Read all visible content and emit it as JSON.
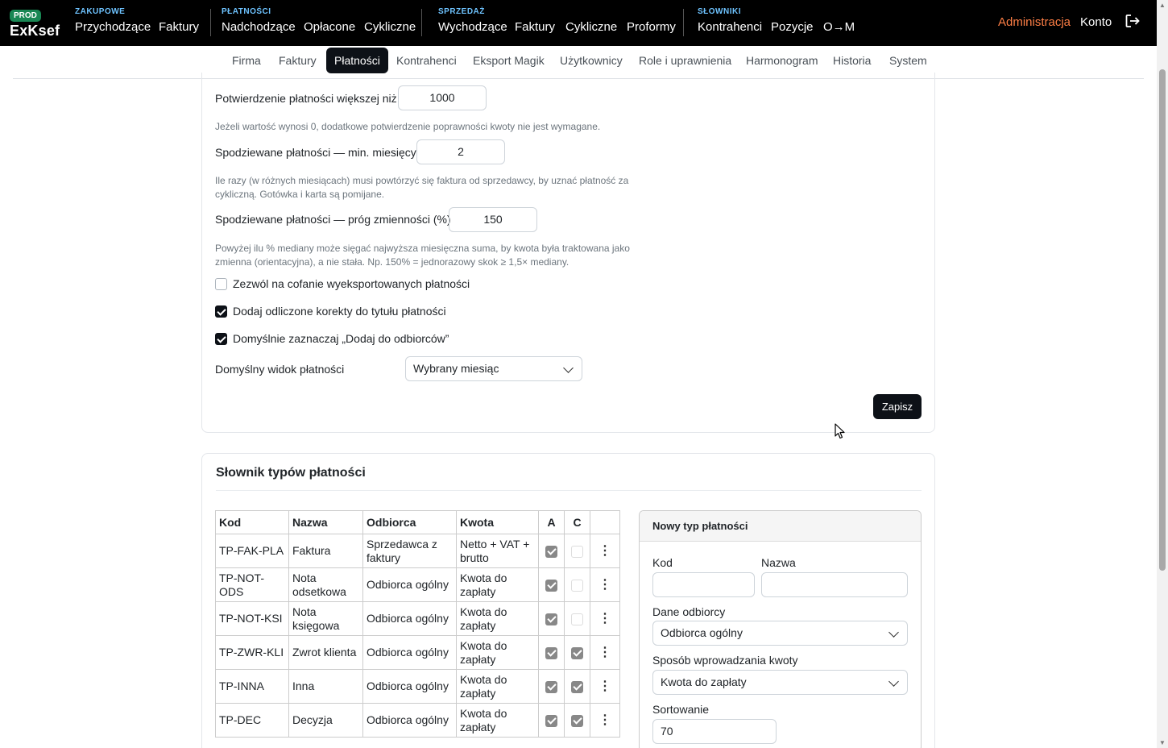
{
  "brand": {
    "badge": "PROD",
    "name": "ExKsef"
  },
  "nav": {
    "groups": [
      {
        "label": "ZAKUPOWE",
        "items": [
          "Przychodzące",
          "Faktury"
        ]
      },
      {
        "label": "PŁATNOŚCI",
        "items": [
          "Nadchodzące",
          "Opłacone",
          "Cykliczne"
        ]
      },
      {
        "label": "SPRZEDAŻ",
        "items": [
          "Wychodzące",
          "Faktury",
          "Cykliczne",
          "Proformy"
        ]
      },
      {
        "label": "SŁOWNIKI",
        "items": [
          "Kontrahenci",
          "Pozycje",
          "O→M"
        ]
      }
    ],
    "admin": "Administracja",
    "account": "Konto",
    "logout_icon": "logout-icon"
  },
  "tabs": [
    "Firma",
    "Faktury",
    "Płatności",
    "Kontrahenci",
    "Eksport Magik",
    "Użytkownicy",
    "Role i uprawnienia",
    "Harmonogram",
    "Historia",
    "System"
  ],
  "active_tab": "Płatności",
  "settings": {
    "confirm_label": "Potwierdzenie płatności większej niż",
    "confirm_value": "1000",
    "confirm_help": "Jeżeli wartość wynosi 0, dodatkowe potwierdzenie poprawności kwoty nie jest wymagane.",
    "min_months_label": "Spodziewane płatności — min. miesięcy",
    "min_months_value": "2",
    "min_months_help": "Ile razy (w różnych miesiącach) musi powtórzyć się faktura od sprzedawcy, by uznać płatność za cykliczną. Gotówka i karta są pomijane.",
    "variance_label": "Spodziewane płatności — próg zmienności (%)",
    "variance_value": "150",
    "variance_help": "Powyżej ilu % mediany może sięgać najwyższa miesięczna suma, by kwota była traktowana jako zmienna (orientacyjna), a nie stała. Np. 150% = jednorazowy skok ≥ 1,5× mediany.",
    "allow_revert_label": "Zezwól na cofanie wyeksportowanych płatności",
    "allow_revert": false,
    "add_corrections_label": "Dodaj odliczone korekty do tytułu płatności",
    "add_corrections": true,
    "default_recipients_label": "Domyślnie zaznaczaj „Dodaj do odbiorców”",
    "default_recipients": true,
    "default_view_label": "Domyślny widok płatności",
    "default_view_value": "Wybrany miesiąc",
    "save_label": "Zapisz"
  },
  "dictionary": {
    "title": "Słownik typów płatności",
    "columns": [
      "Kod",
      "Nazwa",
      "Odbiorca",
      "Kwota",
      "A",
      "C"
    ],
    "rows": [
      {
        "code": "TP-FAK-PLA",
        "name": "Faktura",
        "recipient": "Sprzedawca z faktury",
        "amount": "Netto + VAT + brutto",
        "a": true,
        "c": false
      },
      {
        "code": "TP-NOT-ODS",
        "name": "Nota odsetkowa",
        "recipient": "Odbiorca ogólny",
        "amount": "Kwota do zapłaty",
        "a": true,
        "c": false
      },
      {
        "code": "TP-NOT-KSI",
        "name": "Nota księgowa",
        "recipient": "Odbiorca ogólny",
        "amount": "Kwota do zapłaty",
        "a": true,
        "c": false
      },
      {
        "code": "TP-ZWR-KLI",
        "name": "Zwrot klienta",
        "recipient": "Odbiorca ogólny",
        "amount": "Kwota do zapłaty",
        "a": true,
        "c": true
      },
      {
        "code": "TP-INNA",
        "name": "Inna",
        "recipient": "Odbiorca ogólny",
        "amount": "Kwota do zapłaty",
        "a": true,
        "c": true
      },
      {
        "code": "TP-DEC",
        "name": "Decyzja",
        "recipient": "Odbiorca ogólny",
        "amount": "Kwota do zapłaty",
        "a": true,
        "c": true
      }
    ],
    "row_menu_icon": "kebab-icon"
  },
  "new_type": {
    "title": "Nowy typ płatności",
    "code_label": "Kod",
    "code_value": "",
    "name_label": "Nazwa",
    "name_value": "",
    "recipient_label": "Dane odbiorcy",
    "recipient_value": "Odbiorca ogólny",
    "amount_label": "Sposób wprowadzania kwoty",
    "amount_value": "Kwota do zapłaty",
    "sort_label": "Sortowanie",
    "sort_value": "70"
  }
}
